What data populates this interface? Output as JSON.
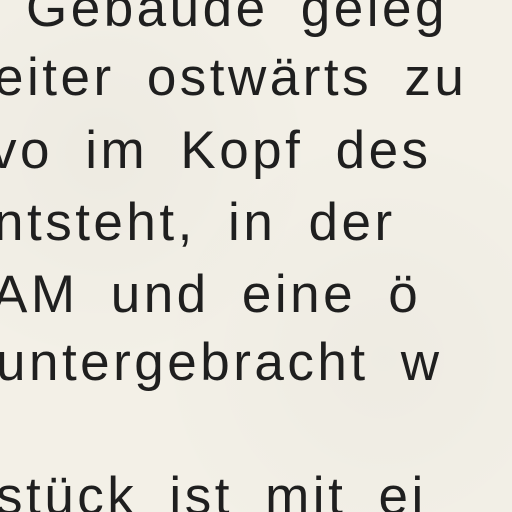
{
  "document": {
    "lines": [
      "Gebäude geleg",
      "eiter ostwärts zu",
      "vo im Kopf des",
      "ntsteht, in der",
      "AM und eine ö",
      "untergebracht w",
      "stück ist mit ei"
    ]
  }
}
